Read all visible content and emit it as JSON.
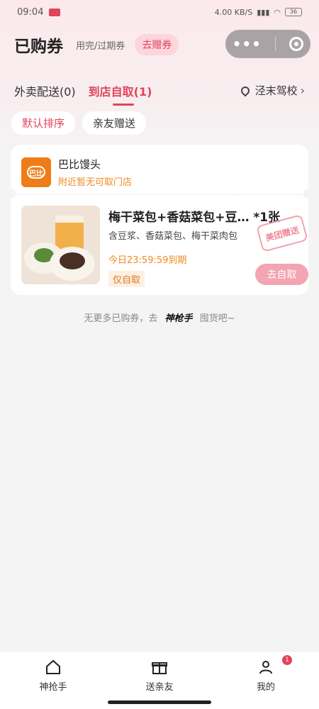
{
  "status_bar": {
    "time": "09:04",
    "network_speed": "4.00 KB/S",
    "battery": "36"
  },
  "header": {
    "title": "已购券",
    "expired_link": "用完/过期券",
    "gift_button": "去赠券"
  },
  "tabs": [
    {
      "label": "外卖配送(0)",
      "active": false
    },
    {
      "label": "到店自取(1)",
      "active": true
    }
  ],
  "location": {
    "label": "泾末驾校"
  },
  "sort_chips": [
    {
      "label": "默认排序",
      "active": true
    },
    {
      "label": "亲友赠送",
      "active": false
    }
  ],
  "voucher": {
    "store_logo_text": "巴比",
    "store_name": "巴比馒头",
    "store_note": "附近暂无可取门店",
    "product_title": "梅干菜包+香菇菜包+豆… *1张",
    "product_desc": "含豆浆、香菇菜包、梅干菜肉包",
    "stamp": "美团赠送",
    "expiry": "今日23:59:59到期",
    "pickup_tag": "仅自取",
    "collect_button": "去自取"
  },
  "footer_note": {
    "prefix": "无更多已购券，去",
    "brand": "神枪手",
    "suffix": "囤货吧~"
  },
  "bottom_nav": [
    {
      "label": "神抢手",
      "icon": "home-icon"
    },
    {
      "label": "送亲友",
      "icon": "gift-icon"
    },
    {
      "label": "我的",
      "icon": "user-icon"
    }
  ],
  "nav_badge": "1",
  "colors": {
    "accent": "#e2435a",
    "orange": "#f08a22",
    "pink_button": "#f3a5b3"
  }
}
